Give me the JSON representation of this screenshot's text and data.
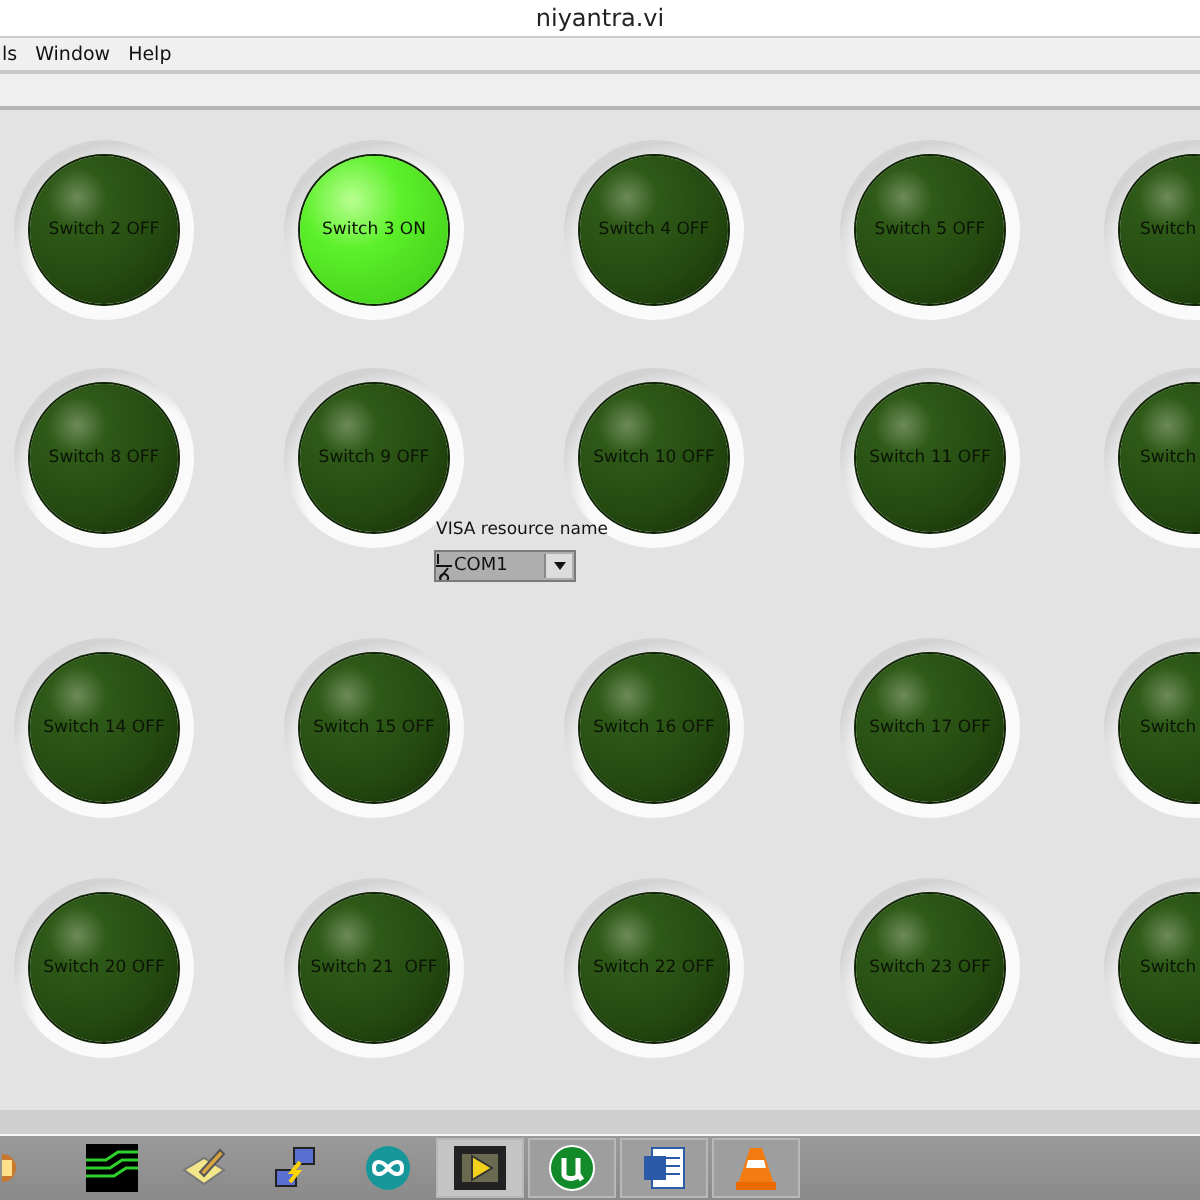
{
  "window": {
    "title": "niyantra.vi"
  },
  "menu": [
    "ls",
    "Window",
    "Help"
  ],
  "switches": [
    {
      "label": "Switch 2 OFF",
      "on": false
    },
    {
      "label": "Switch 3 ON",
      "on": true
    },
    {
      "label": "Switch 4 OFF",
      "on": false
    },
    {
      "label": "Switch 5 OFF",
      "on": false
    },
    {
      "label": "Switch",
      "on": false
    },
    {
      "label": "Switch 8 OFF",
      "on": false
    },
    {
      "label": "Switch 9 OFF",
      "on": false
    },
    {
      "label": "Switch 10 OFF",
      "on": false
    },
    {
      "label": "Switch 11 OFF",
      "on": false
    },
    {
      "label": "Switch",
      "on": false
    },
    {
      "label": "Switch 14 OFF",
      "on": false
    },
    {
      "label": "Switch 15 OFF",
      "on": false
    },
    {
      "label": "Switch 16 OFF",
      "on": false
    },
    {
      "label": "Switch 17 OFF",
      "on": false
    },
    {
      "label": "Switch",
      "on": false
    },
    {
      "label": "Switch 20 OFF",
      "on": false
    },
    {
      "label": "Switch 21  OFF",
      "on": false
    },
    {
      "label": "Switch 22 OFF",
      "on": false
    },
    {
      "label": "Switch 23 OFF",
      "on": false
    },
    {
      "label": "Switch",
      "on": false
    }
  ],
  "visa": {
    "label": "VISA resource name",
    "value": "COM1"
  },
  "taskbar": [
    {
      "kind": "gear",
      "selected": false,
      "running": false
    },
    {
      "kind": "chip",
      "selected": false,
      "running": false
    },
    {
      "kind": "pencil",
      "selected": false,
      "running": false
    },
    {
      "kind": "network",
      "selected": false,
      "running": false
    },
    {
      "kind": "infinity",
      "selected": false,
      "running": false
    },
    {
      "kind": "film",
      "selected": true,
      "running": true
    },
    {
      "kind": "torrent",
      "selected": false,
      "running": true
    },
    {
      "kind": "doc",
      "selected": false,
      "running": true
    },
    {
      "kind": "cone",
      "selected": false,
      "running": true
    }
  ]
}
